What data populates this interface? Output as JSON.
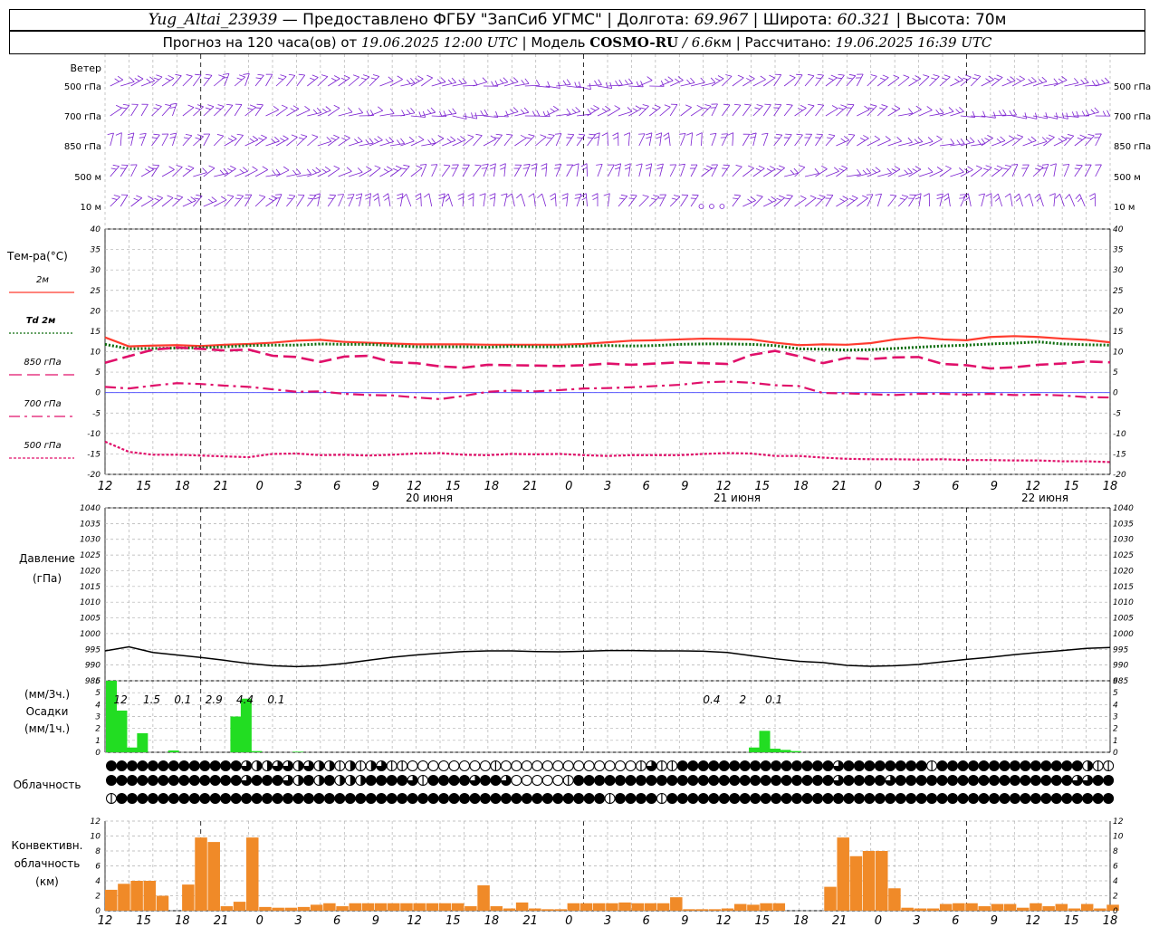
{
  "header": {
    "row1": {
      "station": "Yug_Altai_23939",
      "provider": " — Предоставлено ФГБУ \"ЗапСиб УГМС\" | Долгота: ",
      "lon": "69.967",
      "lat_label": " | Широта: ",
      "lat": "60.321",
      "alt_label": " | Высота: 70м"
    },
    "row2": {
      "fc_label": "Прогноз на 120 часа(ов) от ",
      "fc_time": "19.06.2025 12:00 UTC",
      "model_label": "  | Модель ",
      "model": "COSMO-RU",
      "model_res": " / 6.6",
      "res_unit": "км | Рассчитано: ",
      "calc_time": "19.06.2025 16:39 UTC"
    }
  },
  "labels": {
    "wind": "Ветер",
    "temp_title": "Тем-ра(°C)",
    "pressure": "Давление",
    "pressure_unit": "(гПа)",
    "precip_3h": "(мм/3ч.)",
    "precip": "Осадки",
    "precip_1h": "(мм/1ч.)",
    "cloud": "Облачность",
    "conv_1": "Конвективн.",
    "conv_2": "облачность",
    "conv_3": "(км)"
  },
  "wind_levels": [
    "500 гПа",
    "700 гПа",
    "850 гПа",
    "500 м",
    "10 м"
  ],
  "time_axis": {
    "hour_labels": [
      "12",
      "15",
      "18",
      "21",
      "0",
      "3",
      "6",
      "9",
      "12",
      "15",
      "18",
      "21",
      "0",
      "3",
      "6",
      "9",
      "12",
      "15",
      "18",
      "21",
      "0",
      "3",
      "6",
      "9",
      "12",
      "15",
      "18"
    ],
    "dates": [
      "20 июня",
      "21 июня",
      "22 июня"
    ]
  },
  "colors": {
    "t2m": "#ff3b2e",
    "td2m": "#0a6b0a",
    "t850": "#e0106a",
    "t700": "#e0106a",
    "t500": "#e0106a",
    "wind": "#7a1fd0",
    "precip": "#22dd22",
    "conv": "#f08a28",
    "pressure": "#000000",
    "zero": "#4040ff"
  },
  "chart_data": [
    {
      "type": "line",
      "title": "Тем-ра(°C)",
      "x": [
        0,
        3,
        6,
        9,
        12,
        15,
        18,
        21,
        24,
        27,
        30,
        33,
        36,
        39,
        42,
        45,
        48,
        51,
        54,
        57,
        60,
        63,
        66,
        69,
        72,
        75,
        78,
        81,
        84,
        87,
        90,
        93,
        96,
        99,
        102,
        105,
        108,
        111,
        114,
        117,
        120,
        123,
        126
      ],
      "ylim": [
        -20,
        40
      ],
      "yticks": [
        -20,
        -15,
        -10,
        -5,
        0,
        5,
        10,
        15,
        20,
        25,
        30,
        35,
        40
      ],
      "series": [
        {
          "name": "2м",
          "style": "solid",
          "values": [
            13.5,
            11.3,
            11.5,
            11.6,
            11.4,
            11.7,
            11.9,
            12.2,
            12.7,
            12.9,
            12.4,
            12.2,
            12.0,
            11.8,
            11.8,
            11.8,
            11.7,
            11.7,
            11.7,
            11.7,
            11.9,
            12.3,
            12.7,
            12.8,
            13.0,
            13.2,
            13.1,
            13.0,
            12.2,
            11.6,
            11.8,
            11.7,
            12.1,
            13.0,
            13.5,
            13.0,
            12.8,
            13.6,
            13.8,
            13.6,
            13.2,
            12.9,
            12.3
          ]
        },
        {
          "name": "Td 2м",
          "style": "dotted",
          "values": [
            11.8,
            10.7,
            10.8,
            10.9,
            11.0,
            11.2,
            11.5,
            11.6,
            11.6,
            11.9,
            11.8,
            11.8,
            11.5,
            11.2,
            11.2,
            11.2,
            11.1,
            11.3,
            11.2,
            11.2,
            11.4,
            11.5,
            11.4,
            11.5,
            11.8,
            11.9,
            11.9,
            11.8,
            11.5,
            10.7,
            10.6,
            10.4,
            10.5,
            10.8,
            11.1,
            11.4,
            11.6,
            11.9,
            12.1,
            12.4,
            11.9,
            11.7,
            11.6
          ]
        },
        {
          "name": "850 гПа",
          "style": "dashed",
          "values": [
            7.3,
            8.9,
            10.5,
            11.0,
            10.7,
            10.3,
            10.5,
            9.0,
            8.7,
            7.5,
            8.8,
            9.0,
            7.4,
            7.2,
            6.4,
            6.1,
            6.8,
            6.7,
            6.6,
            6.5,
            6.7,
            7.1,
            6.8,
            7.1,
            7.4,
            7.2,
            7.0,
            9.2,
            10.2,
            8.9,
            7.2,
            8.5,
            8.2,
            8.6,
            8.7,
            7.0,
            6.7,
            5.9,
            6.2,
            6.8,
            7.1,
            7.6,
            7.4
          ]
        },
        {
          "name": "700 гПа",
          "style": "dashdot",
          "values": [
            1.4,
            1.0,
            1.7,
            2.3,
            2.1,
            1.7,
            1.4,
            0.8,
            0.2,
            0.3,
            -0.3,
            -0.6,
            -0.7,
            -1.2,
            -1.6,
            -0.8,
            0.2,
            0.5,
            0.3,
            0.6,
            1.0,
            1.1,
            1.3,
            1.6,
            1.9,
            2.5,
            2.7,
            2.4,
            1.8,
            1.6,
            -0.1,
            -0.2,
            -0.4,
            -0.6,
            -0.3,
            -0.3,
            -0.5,
            -0.3,
            -0.6,
            -0.5,
            -0.7,
            -1.1,
            -1.2
          ]
        },
        {
          "name": "500 гПа",
          "style": "dotted",
          "values": [
            -12.0,
            -14.5,
            -15.2,
            -15.2,
            -15.4,
            -15.6,
            -15.8,
            -15.0,
            -14.9,
            -15.3,
            -15.2,
            -15.4,
            -15.2,
            -14.9,
            -14.8,
            -15.2,
            -15.3,
            -15.0,
            -15.1,
            -15.0,
            -15.3,
            -15.5,
            -15.3,
            -15.3,
            -15.3,
            -15.0,
            -14.8,
            -14.9,
            -15.5,
            -15.5,
            -15.9,
            -16.2,
            -16.3,
            -16.3,
            -16.4,
            -16.3,
            -16.5,
            -16.5,
            -16.6,
            -16.6,
            -16.8,
            -16.8,
            -17.0
          ]
        }
      ]
    },
    {
      "type": "line",
      "title": "Давление",
      "ylabel": "(гПа)",
      "x": [
        0,
        3,
        6,
        9,
        12,
        15,
        18,
        21,
        24,
        27,
        30,
        33,
        36,
        39,
        42,
        45,
        48,
        51,
        54,
        57,
        60,
        63,
        66,
        69,
        72,
        75,
        78,
        81,
        84,
        87,
        90,
        93,
        96,
        99,
        102,
        105,
        108,
        111,
        114,
        117,
        120,
        123,
        126
      ],
      "ylim": [
        985,
        1040
      ],
      "yticks": [
        985,
        990,
        995,
        1000,
        1005,
        1010,
        1015,
        1020,
        1025,
        1030,
        1035,
        1040
      ],
      "series": [
        {
          "name": "pressure",
          "values": [
            994.5,
            995.8,
            994.0,
            993.2,
            992.4,
            991.5,
            990.5,
            989.8,
            989.5,
            989.8,
            990.5,
            991.5,
            992.5,
            993.2,
            993.8,
            994.3,
            994.5,
            994.5,
            994.3,
            994.2,
            994.4,
            994.6,
            994.6,
            994.5,
            994.5,
            994.4,
            994.0,
            993.0,
            992.0,
            991.2,
            990.8,
            989.9,
            989.6,
            989.8,
            990.2,
            991.0,
            991.8,
            992.5,
            993.3,
            994.0,
            994.6,
            995.3,
            995.6
          ]
        }
      ]
    },
    {
      "type": "bar",
      "title": "Осадки",
      "ylabel": "(мм/1ч.)",
      "ylim": [
        0,
        6
      ],
      "yticks": [
        0,
        1,
        2,
        3,
        4,
        5,
        6
      ],
      "bars": [
        {
          "x": 0,
          "value": 6.0
        },
        {
          "x": 1,
          "value": 3.5
        },
        {
          "x": 2,
          "value": 0.4
        },
        {
          "x": 3,
          "value": 1.6
        },
        {
          "x": 6,
          "value": 0.15
        },
        {
          "x": 12,
          "value": 3.0
        },
        {
          "x": 13,
          "value": 4.5
        },
        {
          "x": 14,
          "value": 0.1
        },
        {
          "x": 18,
          "value": 0.05
        },
        {
          "x": 62,
          "value": 0.4
        },
        {
          "x": 63,
          "value": 1.8
        },
        {
          "x": 64,
          "value": 0.3
        },
        {
          "x": 65,
          "value": 0.2
        },
        {
          "x": 66,
          "value": 0.1
        }
      ],
      "annotations": [
        {
          "x": 1.5,
          "text": "12"
        },
        {
          "x": 4.5,
          "text": "1.5"
        },
        {
          "x": 7.5,
          "text": "0.1"
        },
        {
          "x": 10.5,
          "text": "2.9"
        },
        {
          "x": 13.5,
          "text": "4.4"
        },
        {
          "x": 16.5,
          "text": "0.1"
        },
        {
          "x": 58.5,
          "text": "0.4"
        },
        {
          "x": 61.5,
          "text": "2"
        },
        {
          "x": 64.5,
          "text": "0.1"
        }
      ]
    },
    {
      "type": "bar",
      "title": "Конвективн. облачность",
      "ylabel": "(км)",
      "ylim": [
        0,
        12
      ],
      "yticks": [
        0,
        2,
        4,
        6,
        8,
        10,
        12
      ],
      "bars": [
        {
          "x": 0,
          "value": 2.8
        },
        {
          "x": 1,
          "value": 3.6
        },
        {
          "x": 2,
          "value": 4.0
        },
        {
          "x": 3,
          "value": 4.0
        },
        {
          "x": 4,
          "value": 2.0
        },
        {
          "x": 6,
          "value": 3.5
        },
        {
          "x": 7,
          "value": 9.8
        },
        {
          "x": 8,
          "value": 9.2
        },
        {
          "x": 9,
          "value": 0.6
        },
        {
          "x": 10,
          "value": 1.2
        },
        {
          "x": 11,
          "value": 9.8
        },
        {
          "x": 12,
          "value": 0.5
        },
        {
          "x": 13,
          "value": 0.4
        },
        {
          "x": 14,
          "value": 0.4
        },
        {
          "x": 15,
          "value": 0.5
        },
        {
          "x": 16,
          "value": 0.8
        },
        {
          "x": 17,
          "value": 1.0
        },
        {
          "x": 18,
          "value": 0.6
        },
        {
          "x": 19,
          "value": 1.0
        },
        {
          "x": 20,
          "value": 1.0
        },
        {
          "x": 21,
          "value": 1.0
        },
        {
          "x": 22,
          "value": 1.0
        },
        {
          "x": 23,
          "value": 1.0
        },
        {
          "x": 24,
          "value": 1.0
        },
        {
          "x": 25,
          "value": 1.0
        },
        {
          "x": 26,
          "value": 1.0
        },
        {
          "x": 27,
          "value": 1.0
        },
        {
          "x": 28,
          "value": 0.6
        },
        {
          "x": 29,
          "value": 3.4
        },
        {
          "x": 30,
          "value": 0.6
        },
        {
          "x": 31,
          "value": 0.3
        },
        {
          "x": 32,
          "value": 1.1
        },
        {
          "x": 33,
          "value": 0.3
        },
        {
          "x": 34,
          "value": 0.2
        },
        {
          "x": 35,
          "value": 0.2
        },
        {
          "x": 36,
          "value": 1.0
        },
        {
          "x": 37,
          "value": 1.0
        },
        {
          "x": 38,
          "value": 1.0
        },
        {
          "x": 39,
          "value": 1.0
        },
        {
          "x": 40,
          "value": 1.1
        },
        {
          "x": 41,
          "value": 1.0
        },
        {
          "x": 42,
          "value": 1.0
        },
        {
          "x": 43,
          "value": 1.0
        },
        {
          "x": 44,
          "value": 1.8
        },
        {
          "x": 45,
          "value": 0.2
        },
        {
          "x": 46,
          "value": 0.2
        },
        {
          "x": 47,
          "value": 0.2
        },
        {
          "x": 48,
          "value": 0.3
        },
        {
          "x": 49,
          "value": 0.9
        },
        {
          "x": 50,
          "value": 0.8
        },
        {
          "x": 51,
          "value": 1.0
        },
        {
          "x": 52,
          "value": 1.0
        },
        {
          "x": 56,
          "value": 3.2
        },
        {
          "x": 57,
          "value": 9.8
        },
        {
          "x": 58,
          "value": 7.3
        },
        {
          "x": 59,
          "value": 8.0
        },
        {
          "x": 60,
          "value": 8.0
        },
        {
          "x": 61,
          "value": 3.0
        },
        {
          "x": 62,
          "value": 0.4
        },
        {
          "x": 63,
          "value": 0.3
        },
        {
          "x": 64,
          "value": 0.3
        },
        {
          "x": 65,
          "value": 0.9
        },
        {
          "x": 66,
          "value": 1.0
        },
        {
          "x": 67,
          "value": 1.0
        },
        {
          "x": 68,
          "value": 0.6
        },
        {
          "x": 69,
          "value": 0.9
        },
        {
          "x": 70,
          "value": 0.9
        },
        {
          "x": 71,
          "value": 0.4
        },
        {
          "x": 72,
          "value": 1.0
        },
        {
          "x": 73,
          "value": 0.6
        },
        {
          "x": 74,
          "value": 0.9
        },
        {
          "x": 75,
          "value": 0.3
        },
        {
          "x": 76,
          "value": 0.9
        },
        {
          "x": 77,
          "value": 0.3
        },
        {
          "x": 78,
          "value": 0.8
        }
      ]
    }
  ],
  "clouds": {
    "rows": [
      [
        4,
        4,
        4,
        4,
        4,
        4,
        4,
        4,
        4,
        4,
        4,
        4,
        4,
        3,
        2,
        2,
        3,
        3,
        2,
        3,
        2,
        2,
        1,
        2,
        1,
        2,
        3,
        1,
        1,
        0,
        0,
        0,
        0,
        0,
        0,
        0,
        0,
        1,
        0,
        0,
        0,
        0,
        0,
        0,
        0,
        0,
        0,
        0,
        0,
        0,
        0,
        1,
        3,
        1,
        1,
        4,
        4,
        4,
        4,
        4,
        4,
        4,
        4,
        4,
        4,
        4,
        4,
        4,
        4,
        4,
        3,
        4,
        4,
        4,
        4,
        4,
        4,
        4,
        4,
        1,
        4,
        4,
        4,
        4,
        4,
        4,
        4,
        4,
        4,
        4,
        4,
        4,
        4,
        4,
        2,
        1,
        1
      ],
      [
        4,
        4,
        4,
        4,
        4,
        4,
        4,
        4,
        4,
        4,
        4,
        4,
        4,
        3,
        4,
        4,
        4,
        3,
        2,
        4,
        2,
        4,
        2,
        2,
        2,
        4,
        4,
        4,
        4,
        3,
        1,
        4,
        4,
        4,
        4,
        3,
        4,
        4,
        3,
        0,
        0,
        0,
        0,
        0,
        1,
        4,
        4,
        4,
        4,
        4,
        4,
        4,
        4,
        4,
        4,
        4,
        4,
        4,
        4,
        4,
        4,
        4,
        4,
        4,
        4,
        4,
        4,
        4,
        4,
        4,
        3,
        4,
        4,
        4,
        4,
        3,
        4,
        4,
        4,
        4,
        4,
        4,
        4,
        4,
        4,
        4,
        4,
        4,
        4,
        4,
        4,
        4,
        4,
        3,
        3,
        4,
        4
      ],
      [
        1,
        4,
        4,
        4,
        4,
        4,
        4,
        4,
        4,
        4,
        4,
        4,
        4,
        4,
        4,
        4,
        4,
        4,
        4,
        4,
        4,
        4,
        4,
        4,
        4,
        4,
        4,
        4,
        4,
        4,
        4,
        4,
        4,
        4,
        4,
        4,
        4,
        4,
        4,
        4,
        4,
        4,
        4,
        4,
        4,
        4,
        4,
        4,
        1,
        4,
        4,
        4,
        4,
        1,
        4,
        4,
        4,
        4,
        4,
        4,
        4,
        4,
        4,
        4,
        4,
        4,
        4,
        4,
        4,
        4,
        4,
        4,
        4,
        4,
        4,
        4,
        4,
        4,
        4,
        4,
        4,
        4,
        4,
        4,
        4,
        4,
        4,
        4,
        4,
        4,
        4,
        4,
        4,
        4,
        4,
        4,
        4
      ]
    ]
  }
}
